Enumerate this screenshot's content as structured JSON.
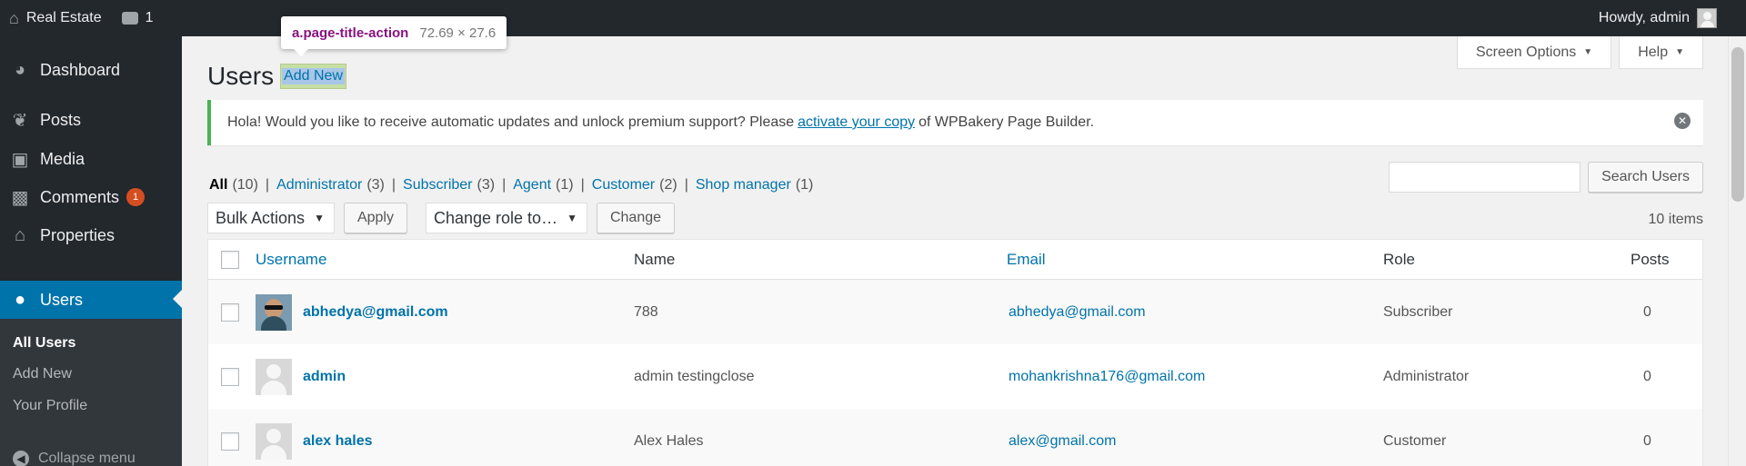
{
  "adminbar": {
    "site_name": "Real Estate",
    "comments_count": "1",
    "greeting": "Howdy, admin"
  },
  "sidebar": {
    "items": [
      {
        "label": "Dashboard",
        "icon": "dashboard-icon"
      },
      {
        "label": "Posts",
        "icon": "pin-icon"
      },
      {
        "label": "Media",
        "icon": "media-icon"
      },
      {
        "label": "Comments",
        "icon": "comment-icon",
        "badge": "1"
      },
      {
        "label": "Properties",
        "icon": "home-icon"
      },
      {
        "label": "Users",
        "icon": "user-icon",
        "current": true
      }
    ],
    "submenu": [
      "All Users",
      "Add New",
      "Your Profile"
    ],
    "collapse_label": "Collapse menu"
  },
  "screen_options": {
    "screen_label": "Screen Options",
    "help_label": "Help"
  },
  "tooltip": {
    "selector": "a.page-title-action",
    "dims": "72.69 × 27.6"
  },
  "page": {
    "title": "Users",
    "add_new": "Add New"
  },
  "notice": {
    "before": "Hola! Would you like to receive automatic updates and unlock premium support? Please",
    "link": "activate your copy",
    "after": "of WPBakery Page Builder."
  },
  "views": [
    {
      "label": "All",
      "count": "(10)",
      "current": true
    },
    {
      "label": "Administrator",
      "count": "(3)"
    },
    {
      "label": "Subscriber",
      "count": "(3)"
    },
    {
      "label": "Agent",
      "count": "(1)"
    },
    {
      "label": "Customer",
      "count": "(2)"
    },
    {
      "label": "Shop manager",
      "count": "(1)"
    }
  ],
  "search": {
    "button": "Search Users",
    "placeholder": ""
  },
  "tablenav": {
    "bulk_actions": "Bulk Actions",
    "apply": "Apply",
    "change_role": "Change role to…",
    "change": "Change",
    "items_count": "10 items"
  },
  "table": {
    "columns": {
      "username": "Username",
      "name": "Name",
      "email": "Email",
      "role": "Role",
      "posts": "Posts"
    },
    "rows": [
      {
        "username": "abhedya@gmail.com",
        "name": "788",
        "email": "abhedya@gmail.com",
        "role": "Subscriber",
        "posts": "0",
        "avatar": "photo"
      },
      {
        "username": "admin",
        "name": "admin testingclose",
        "email": "mohankrishna176@gmail.com",
        "role": "Administrator",
        "posts": "0",
        "avatar": "default"
      },
      {
        "username": "alex hales",
        "name": "Alex Hales",
        "email": "alex@gmail.com",
        "role": "Customer",
        "posts": "0",
        "avatar": "default"
      }
    ]
  },
  "colors": {
    "accent": "#0073aa",
    "adminbar": "#23282d",
    "notice_success": "#46b450",
    "badge": "#d54e21"
  }
}
